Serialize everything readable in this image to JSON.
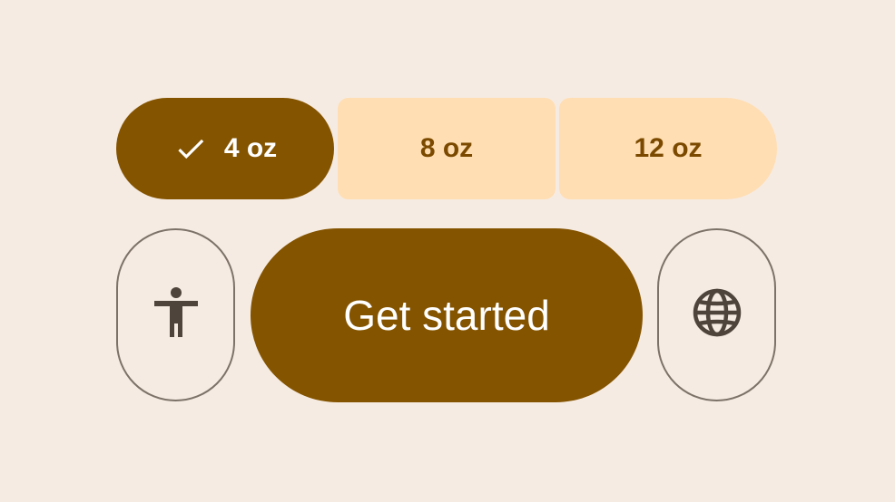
{
  "size_selector": {
    "options": [
      {
        "label": "4 oz",
        "selected": true
      },
      {
        "label": "8 oz",
        "selected": false
      },
      {
        "label": "12 oz",
        "selected": false
      }
    ],
    "selected_icon": "check-icon"
  },
  "actions": {
    "left_icon": "accessibility-icon",
    "primary_label": "Get started",
    "right_icon": "globe-icon"
  },
  "colors": {
    "background": "#f6ebe2",
    "primary": "#845400",
    "segment_unselected_bg": "#ffdeb3",
    "segment_unselected_text": "#7b4a00",
    "outline": "#7d7268",
    "icon": "#4e443c"
  }
}
